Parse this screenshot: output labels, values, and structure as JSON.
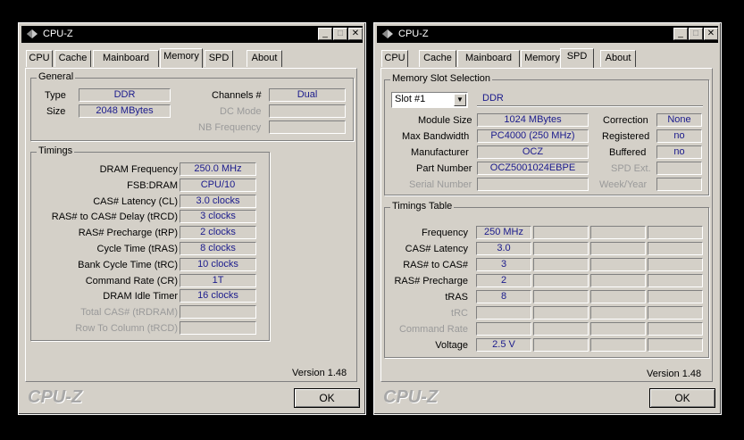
{
  "left_window": {
    "title": "CPU-Z",
    "tabs": [
      "CPU",
      "Cache",
      "Mainboard",
      "Memory",
      "SPD",
      "About"
    ],
    "active_tab": "Memory",
    "general": {
      "title": "General",
      "type_label": "Type",
      "type_value": "DDR",
      "size_label": "Size",
      "size_value": "2048 MBytes",
      "channels_label": "Channels #",
      "channels_value": "Dual",
      "dc_mode_label": "DC Mode",
      "dc_mode_value": "",
      "nb_freq_label": "NB Frequency",
      "nb_freq_value": ""
    },
    "timings": {
      "title": "Timings",
      "rows": [
        {
          "label": "DRAM Frequency",
          "value": "250.0 MHz",
          "disabled": false
        },
        {
          "label": "FSB:DRAM",
          "value": "CPU/10",
          "disabled": false
        },
        {
          "label": "CAS# Latency (CL)",
          "value": "3.0 clocks",
          "disabled": false
        },
        {
          "label": "RAS# to CAS# Delay (tRCD)",
          "value": "3 clocks",
          "disabled": false
        },
        {
          "label": "RAS# Precharge (tRP)",
          "value": "2 clocks",
          "disabled": false
        },
        {
          "label": "Cycle Time (tRAS)",
          "value": "8 clocks",
          "disabled": false
        },
        {
          "label": "Bank Cycle Time (tRC)",
          "value": "10 clocks",
          "disabled": false
        },
        {
          "label": "Command Rate (CR)",
          "value": "1T",
          "disabled": false
        },
        {
          "label": "DRAM Idle Timer",
          "value": "16 clocks",
          "disabled": false
        },
        {
          "label": "Total CAS# (tRDRAM)",
          "value": "",
          "disabled": true
        },
        {
          "label": "Row To Column (tRCD)",
          "value": "",
          "disabled": true
        }
      ]
    },
    "version": "Version 1.48",
    "logo": "CPU-Z",
    "ok_label": "OK"
  },
  "right_window": {
    "title": "CPU-Z",
    "tabs": [
      "CPU",
      "Cache",
      "Mainboard",
      "Memory",
      "SPD",
      "About"
    ],
    "active_tab": "SPD",
    "slot": {
      "title": "Memory Slot Selection",
      "selected": "Slot #1",
      "type_value": "DDR",
      "module_size_label": "Module Size",
      "module_size_value": "1024 MBytes",
      "max_bw_label": "Max Bandwidth",
      "max_bw_value": "PC4000 (250 MHz)",
      "manufacturer_label": "Manufacturer",
      "manufacturer_value": "OCZ",
      "part_label": "Part Number",
      "part_value": "OCZ5001024EBPE",
      "serial_label": "Serial Number",
      "serial_value": "",
      "correction_label": "Correction",
      "correction_value": "None",
      "registered_label": "Registered",
      "registered_value": "no",
      "buffered_label": "Buffered",
      "buffered_value": "no",
      "spd_ext_label": "SPD Ext.",
      "spd_ext_value": "",
      "week_year_label": "Week/Year",
      "week_year_value": ""
    },
    "timings_table": {
      "title": "Timings Table",
      "rows": [
        {
          "label": "Frequency",
          "value": "250 MHz",
          "disabled": false
        },
        {
          "label": "CAS# Latency",
          "value": "3.0",
          "disabled": false
        },
        {
          "label": "RAS# to CAS#",
          "value": "3",
          "disabled": false
        },
        {
          "label": "RAS# Precharge",
          "value": "2",
          "disabled": false
        },
        {
          "label": "tRAS",
          "value": "8",
          "disabled": false
        },
        {
          "label": "tRC",
          "value": "",
          "disabled": true
        },
        {
          "label": "Command Rate",
          "value": "",
          "disabled": true
        },
        {
          "label": "Voltage",
          "value": "2.5 V",
          "disabled": false
        }
      ]
    },
    "version": "Version 1.48",
    "logo": "CPU-Z",
    "ok_label": "OK"
  }
}
